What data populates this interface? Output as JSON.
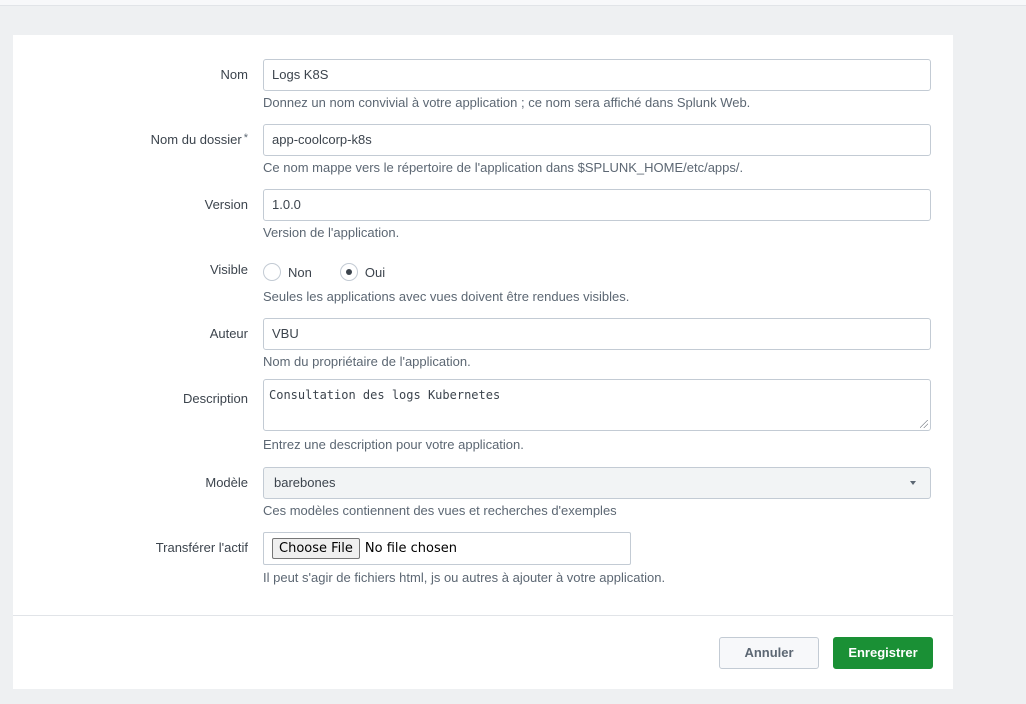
{
  "form": {
    "name": {
      "label": "Nom",
      "value": "Logs K8S",
      "help": "Donnez un nom convivial à votre application ; ce nom sera affiché dans Splunk Web."
    },
    "folder": {
      "label": "Nom du dossier",
      "required_mark": "*",
      "value": "app-coolcorp-k8s",
      "help": "Ce nom mappe vers le répertoire de l'application dans $SPLUNK_HOME/etc/apps/."
    },
    "version": {
      "label": "Version",
      "value": "1.0.0",
      "help": "Version de l'application."
    },
    "visible": {
      "label": "Visible",
      "options": [
        "Non",
        "Oui"
      ],
      "selected": "Oui",
      "help": "Seules les applications avec vues doivent être rendues visibles."
    },
    "author": {
      "label": "Auteur",
      "value": "VBU",
      "help": "Nom du propriétaire de l'application."
    },
    "description": {
      "label": "Description",
      "value": "Consultation des logs Kubernetes",
      "help": "Entrez une description pour votre application."
    },
    "template": {
      "label": "Modèle",
      "value": "barebones",
      "help": "Ces modèles contiennent des vues et recherches d'exemples"
    },
    "upload": {
      "label": "Transférer l'actif",
      "button_label": "Choose File",
      "status": "No file chosen",
      "help": "Il peut s'agir de fichiers html, js ou autres à ajouter à votre application."
    }
  },
  "footer": {
    "cancel_label": "Annuler",
    "save_label": "Enregistrer"
  },
  "colors": {
    "primary": "#1a9035",
    "border": "#c3cbd4",
    "help_text": "#5c6773"
  },
  "icons": {
    "select_caret": "chevron-down-icon",
    "textarea_resize": "resize-handle-icon"
  }
}
